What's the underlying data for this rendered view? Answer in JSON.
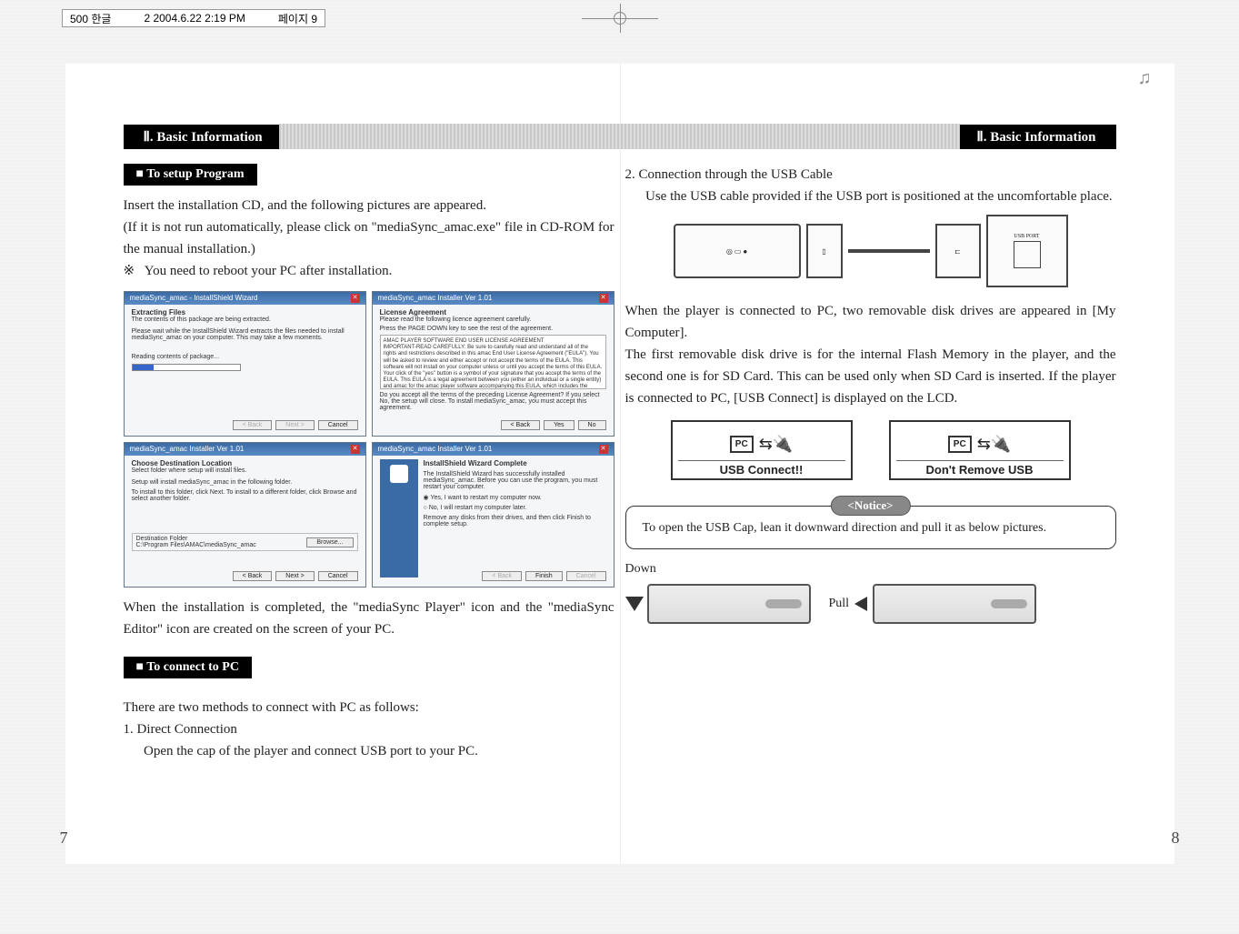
{
  "top_bar": {
    "left": "500 한글",
    "mid": "2  2004.6.22 2:19 PM",
    "right": "페이지 9"
  },
  "section_header": {
    "left": "Ⅱ. Basic Information",
    "right": "Ⅱ. Basic Information"
  },
  "left_page": {
    "label1": "To setup Program",
    "p1": "Insert the installation CD, and the following pictures are appeared.",
    "p2": "(If it is not run automatically, please click on \"mediaSync_amac.exe\" file in CD-ROM for the manual installation.)",
    "p3_prefix": "※",
    "p3": "You need to reboot your PC after installation.",
    "shots": {
      "s1": {
        "title": "mediaSync_amac - InstallShield Wizard",
        "h": "Extracting Files",
        "sub": "The contents of this package are being extracted.",
        "body": "Please wait while the InstallShield Wizard extracts the files needed to install mediaSync_amac on your computer. This may take a few moments.",
        "status": "Reading contents of package...",
        "btn_back": "< Back",
        "btn_next": "Next >",
        "btn_cancel": "Cancel"
      },
      "s2": {
        "title": "mediaSync_amac Installer Ver 1.01",
        "h": "License Agreement",
        "sub": "Please read the following licence agreement carefully.",
        "hint": "Press the PAGE DOWN key to see the rest of the agreement.",
        "ta_title": "AMAC PLAYER SOFTWARE END USER LICENSE AGREEMENT",
        "ta_body": "IMPORTANT-READ CAREFULLY: Be sure to carefully read and understand all of the rights and restrictions described in this amac End User License Agreement (\"EULA\"). You will be asked to review and either accept or not accept the terms of the EULA. This software will not install on your computer unless or until you accept the terms of this EULA. Your click of the \"yes\" button is a symbol of your signature that you accept the terms of the EULA.\nThis EULA is a legal agreement between you (either an individual or a single entity) and amac for the amac player software accompanying this EULA, which includes the",
        "q": "Do you accept all the terms of the preceding License Agreement? If you select No, the setup will close. To install mediaSync_amac, you must accept this agreement.",
        "btn_back": "< Back",
        "btn_yes": "Yes",
        "btn_no": "No"
      },
      "s3": {
        "title": "mediaSync_amac Installer Ver 1.01",
        "h": "Choose Destination Location",
        "sub": "Select folder where setup will install files.",
        "body1": "Setup will install mediaSync_amac in the following folder.",
        "body2": "To install to this folder, click Next. To install to a different folder, click Browse and select another folder.",
        "dest_label": "Destination Folder",
        "dest_path": "C:\\Program Files\\AMAC\\mediaSync_amac",
        "btn_browse": "Browse...",
        "btn_back": "< Back",
        "btn_next": "Next >",
        "btn_cancel": "Cancel"
      },
      "s4": {
        "title": "mediaSync_amac Installer Ver 1.01",
        "h": "InstallShield Wizard Complete",
        "body": "The InstallShield Wizard has successfully installed mediaSync_amac. Before you can use the program, you must restart your computer.",
        "opt1": "Yes, I want to restart my computer now.",
        "opt2": "No, I will restart my computer later.",
        "body2": "Remove any disks from their drives, and then click Finish to complete setup.",
        "btn_back": "< Back",
        "btn_finish": "Finish",
        "btn_cancel": "Cancel"
      }
    },
    "p_after": "When the installation is completed, the \"mediaSync Player\" icon and the \"mediaSync Editor\" icon are created on the screen of your PC.",
    "label2": "To connect to PC",
    "p4": "There are two methods to connect with PC as follows:",
    "p5": "1. Direct Connection",
    "p6": "Open the cap of the player and connect USB port to your PC.",
    "page_num": "7"
  },
  "right_page": {
    "p1": "2. Connection through the USB Cable",
    "p2": "Use the USB cable provided if the USB port is positioned at the uncomfortable place.",
    "usb_port_label": "USB PORT",
    "p3": "When the player is connected to PC, two removable disk drives are appeared in [My Computer].",
    "p4": "The first removable disk drive is for the internal Flash Memory in the player, and the second one is for SD Card. This can be used only when SD Card is inserted. If the player is connected to PC, [USB Connect] is displayed on the LCD.",
    "lcd1": "USB Connect!!",
    "lcd2": "Don't Remove USB",
    "notice_tag": "<Notice>",
    "notice_body": "To open the USB Cap, lean it downward direction and pull it as below pictures.",
    "down_label": "Down",
    "pull_label": "Pull",
    "page_num": "8"
  },
  "icons": {
    "music_note": "♫",
    "pc": "PC",
    "usb": "⇄USB"
  }
}
